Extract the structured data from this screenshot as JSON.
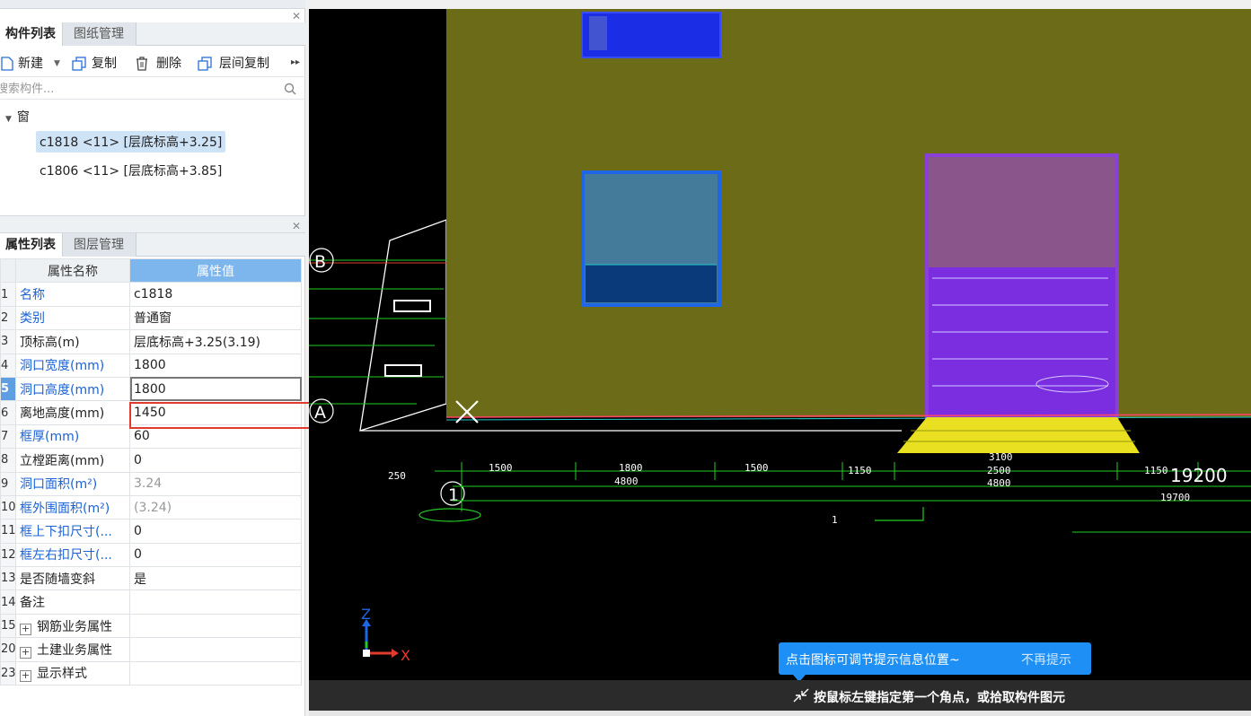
{
  "panel1": {
    "tabs": [
      "构件列表",
      "图纸管理"
    ],
    "toolbar": {
      "new_label": "新建",
      "copy_label": "复制",
      "delete_label": "删除",
      "floor_copy_label": "层间复制"
    },
    "search_placeholder": "搜索构件...",
    "tree": {
      "group": "窗",
      "items": [
        "c1818 <11> [层底标高+3.25]",
        "c1806 <11> [层底标高+3.85]"
      ]
    }
  },
  "panel2": {
    "tabs": [
      "属性列表",
      "图层管理"
    ],
    "headers": [
      "属性名称",
      "属性值"
    ],
    "rows": [
      {
        "idx": "1",
        "name": "名称",
        "value": "c1818"
      },
      {
        "idx": "2",
        "name": "类别",
        "value": "普通窗"
      },
      {
        "idx": "3",
        "name": "顶标高(m)",
        "value": "层底标高+3.25(3.19)"
      },
      {
        "idx": "4",
        "name": "洞口宽度(mm)",
        "value": "1800"
      },
      {
        "idx": "5",
        "name": "洞口高度(mm)",
        "value": "1800"
      },
      {
        "idx": "6",
        "name": "离地高度(mm)",
        "value": "1450"
      },
      {
        "idx": "7",
        "name": "框厚(mm)",
        "value": "60"
      },
      {
        "idx": "8",
        "name": "立樘距离(mm)",
        "value": "0"
      },
      {
        "idx": "9",
        "name": "洞口面积(m²)",
        "value": "3.24"
      },
      {
        "idx": "10",
        "name": "框外围面积(m²)",
        "value": "(3.24)"
      },
      {
        "idx": "11",
        "name": "框上下扣尺寸(...",
        "value": "0"
      },
      {
        "idx": "12",
        "name": "框左右扣尺寸(...",
        "value": "0"
      },
      {
        "idx": "13",
        "name": "是否随墙变斜",
        "value": "是"
      },
      {
        "idx": "14",
        "name": "备注",
        "value": ""
      },
      {
        "idx": "15",
        "name": "钢筋业务属性",
        "value": ""
      },
      {
        "idx": "20",
        "name": "土建业务属性",
        "value": ""
      },
      {
        "idx": "23",
        "name": "显示样式",
        "value": ""
      }
    ]
  },
  "canvas": {
    "grid_labels": [
      "B",
      "A",
      "1"
    ],
    "dimensions": [
      "1500",
      "1800",
      "1500",
      "1150",
      "2500",
      "1150",
      "4800",
      "4800",
      "3100",
      "19700",
      "250",
      "1"
    ],
    "total_dimension": "19200",
    "axis_labels": {
      "z": "Z",
      "x": "X"
    },
    "hint_message": "点击图标可调节提示信息位置~",
    "hint_dismiss": "不再提示",
    "status_text": "按鼠标左键指定第一个角点，或拾取构件图元"
  },
  "colors": {
    "wall": "#6b6b18",
    "window_blue": "#1e66e6",
    "door_purple": "#8a3fd6",
    "step_yellow": "#e8e020",
    "selection_red": "#e23b2e",
    "hint_blue": "#1e90f5",
    "header_blue": "#7cb6ec"
  }
}
